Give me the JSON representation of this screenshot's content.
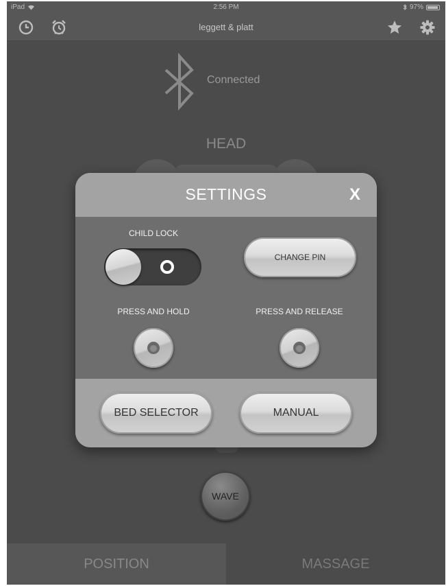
{
  "status_bar": {
    "device": "iPad",
    "time": "2:56 PM",
    "battery": "97%"
  },
  "nav": {
    "title": "leggett & platt",
    "icons": [
      "clock-icon",
      "alarm-icon",
      "star-icon",
      "gear-icon"
    ]
  },
  "connection": {
    "status": "Connected",
    "icon": "bluetooth-icon"
  },
  "background": {
    "head_label": "HEAD",
    "wave_label": "WAVE"
  },
  "modal": {
    "title": "SETTINGS",
    "close_label": "X",
    "child_lock_label": "CHILD LOCK",
    "child_lock_on": false,
    "change_pin_label": "CHANGE PIN",
    "press_hold_label": "PRESS AND HOLD",
    "press_release_label": "PRESS AND RELEASE",
    "bed_selector_label": "BED SELECTOR",
    "manual_label": "MANUAL"
  },
  "tabs": [
    {
      "label": "POSITION",
      "active": true
    },
    {
      "label": "MASSAGE",
      "active": false
    }
  ],
  "colors": {
    "background": "#4b4b4b",
    "modal_header": "#a3a3a3",
    "modal_body": "#6e6e6e"
  }
}
